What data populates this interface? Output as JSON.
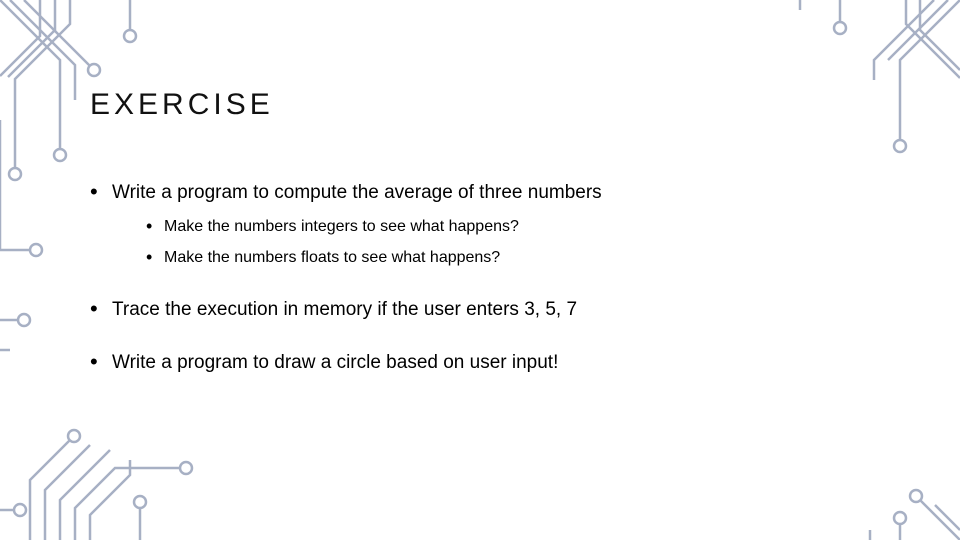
{
  "title": "EXERCISE",
  "bullets": {
    "b1": "Write a program to compute the average of three numbers",
    "b1_sub1": "Make the numbers integers to see what happens?",
    "b1_sub2": "Make the numbers floats to see what happens?",
    "b2": "Trace the execution in memory if the user enters 3, 5, 7",
    "b3": "Write a program to draw a circle based on user input!"
  }
}
